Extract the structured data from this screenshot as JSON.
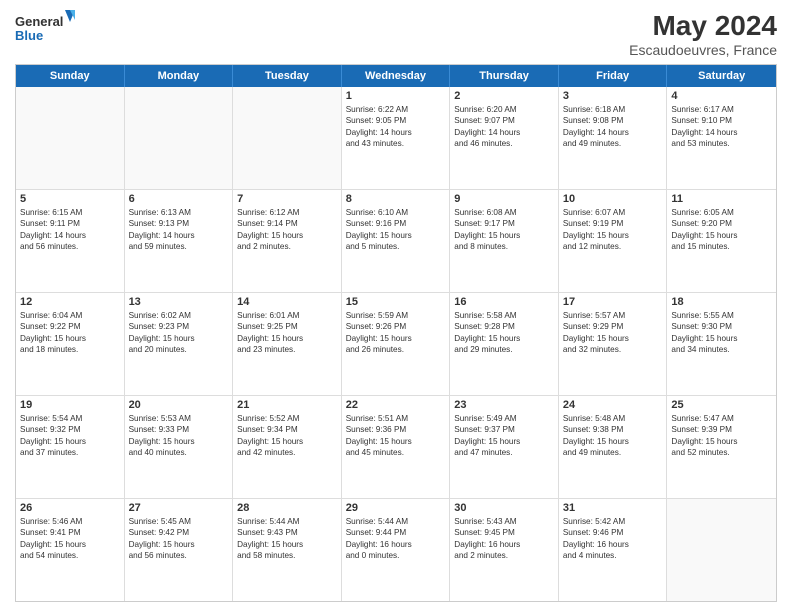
{
  "header": {
    "logo_line1": "General",
    "logo_line2": "Blue",
    "title": "May 2024",
    "subtitle": "Escaudoeuvres, France"
  },
  "days_of_week": [
    "Sunday",
    "Monday",
    "Tuesday",
    "Wednesday",
    "Thursday",
    "Friday",
    "Saturday"
  ],
  "weeks": [
    [
      {
        "day": "",
        "empty": true
      },
      {
        "day": "",
        "empty": true
      },
      {
        "day": "",
        "empty": true
      },
      {
        "day": "1",
        "line1": "Sunrise: 6:22 AM",
        "line2": "Sunset: 9:05 PM",
        "line3": "Daylight: 14 hours",
        "line4": "and 43 minutes."
      },
      {
        "day": "2",
        "line1": "Sunrise: 6:20 AM",
        "line2": "Sunset: 9:07 PM",
        "line3": "Daylight: 14 hours",
        "line4": "and 46 minutes."
      },
      {
        "day": "3",
        "line1": "Sunrise: 6:18 AM",
        "line2": "Sunset: 9:08 PM",
        "line3": "Daylight: 14 hours",
        "line4": "and 49 minutes."
      },
      {
        "day": "4",
        "line1": "Sunrise: 6:17 AM",
        "line2": "Sunset: 9:10 PM",
        "line3": "Daylight: 14 hours",
        "line4": "and 53 minutes."
      }
    ],
    [
      {
        "day": "5",
        "line1": "Sunrise: 6:15 AM",
        "line2": "Sunset: 9:11 PM",
        "line3": "Daylight: 14 hours",
        "line4": "and 56 minutes."
      },
      {
        "day": "6",
        "line1": "Sunrise: 6:13 AM",
        "line2": "Sunset: 9:13 PM",
        "line3": "Daylight: 14 hours",
        "line4": "and 59 minutes."
      },
      {
        "day": "7",
        "line1": "Sunrise: 6:12 AM",
        "line2": "Sunset: 9:14 PM",
        "line3": "Daylight: 15 hours",
        "line4": "and 2 minutes."
      },
      {
        "day": "8",
        "line1": "Sunrise: 6:10 AM",
        "line2": "Sunset: 9:16 PM",
        "line3": "Daylight: 15 hours",
        "line4": "and 5 minutes."
      },
      {
        "day": "9",
        "line1": "Sunrise: 6:08 AM",
        "line2": "Sunset: 9:17 PM",
        "line3": "Daylight: 15 hours",
        "line4": "and 8 minutes."
      },
      {
        "day": "10",
        "line1": "Sunrise: 6:07 AM",
        "line2": "Sunset: 9:19 PM",
        "line3": "Daylight: 15 hours",
        "line4": "and 12 minutes."
      },
      {
        "day": "11",
        "line1": "Sunrise: 6:05 AM",
        "line2": "Sunset: 9:20 PM",
        "line3": "Daylight: 15 hours",
        "line4": "and 15 minutes."
      }
    ],
    [
      {
        "day": "12",
        "line1": "Sunrise: 6:04 AM",
        "line2": "Sunset: 9:22 PM",
        "line3": "Daylight: 15 hours",
        "line4": "and 18 minutes."
      },
      {
        "day": "13",
        "line1": "Sunrise: 6:02 AM",
        "line2": "Sunset: 9:23 PM",
        "line3": "Daylight: 15 hours",
        "line4": "and 20 minutes."
      },
      {
        "day": "14",
        "line1": "Sunrise: 6:01 AM",
        "line2": "Sunset: 9:25 PM",
        "line3": "Daylight: 15 hours",
        "line4": "and 23 minutes."
      },
      {
        "day": "15",
        "line1": "Sunrise: 5:59 AM",
        "line2": "Sunset: 9:26 PM",
        "line3": "Daylight: 15 hours",
        "line4": "and 26 minutes."
      },
      {
        "day": "16",
        "line1": "Sunrise: 5:58 AM",
        "line2": "Sunset: 9:28 PM",
        "line3": "Daylight: 15 hours",
        "line4": "and 29 minutes."
      },
      {
        "day": "17",
        "line1": "Sunrise: 5:57 AM",
        "line2": "Sunset: 9:29 PM",
        "line3": "Daylight: 15 hours",
        "line4": "and 32 minutes."
      },
      {
        "day": "18",
        "line1": "Sunrise: 5:55 AM",
        "line2": "Sunset: 9:30 PM",
        "line3": "Daylight: 15 hours",
        "line4": "and 34 minutes."
      }
    ],
    [
      {
        "day": "19",
        "line1": "Sunrise: 5:54 AM",
        "line2": "Sunset: 9:32 PM",
        "line3": "Daylight: 15 hours",
        "line4": "and 37 minutes."
      },
      {
        "day": "20",
        "line1": "Sunrise: 5:53 AM",
        "line2": "Sunset: 9:33 PM",
        "line3": "Daylight: 15 hours",
        "line4": "and 40 minutes."
      },
      {
        "day": "21",
        "line1": "Sunrise: 5:52 AM",
        "line2": "Sunset: 9:34 PM",
        "line3": "Daylight: 15 hours",
        "line4": "and 42 minutes."
      },
      {
        "day": "22",
        "line1": "Sunrise: 5:51 AM",
        "line2": "Sunset: 9:36 PM",
        "line3": "Daylight: 15 hours",
        "line4": "and 45 minutes."
      },
      {
        "day": "23",
        "line1": "Sunrise: 5:49 AM",
        "line2": "Sunset: 9:37 PM",
        "line3": "Daylight: 15 hours",
        "line4": "and 47 minutes."
      },
      {
        "day": "24",
        "line1": "Sunrise: 5:48 AM",
        "line2": "Sunset: 9:38 PM",
        "line3": "Daylight: 15 hours",
        "line4": "and 49 minutes."
      },
      {
        "day": "25",
        "line1": "Sunrise: 5:47 AM",
        "line2": "Sunset: 9:39 PM",
        "line3": "Daylight: 15 hours",
        "line4": "and 52 minutes."
      }
    ],
    [
      {
        "day": "26",
        "line1": "Sunrise: 5:46 AM",
        "line2": "Sunset: 9:41 PM",
        "line3": "Daylight: 15 hours",
        "line4": "and 54 minutes."
      },
      {
        "day": "27",
        "line1": "Sunrise: 5:45 AM",
        "line2": "Sunset: 9:42 PM",
        "line3": "Daylight: 15 hours",
        "line4": "and 56 minutes."
      },
      {
        "day": "28",
        "line1": "Sunrise: 5:44 AM",
        "line2": "Sunset: 9:43 PM",
        "line3": "Daylight: 15 hours",
        "line4": "and 58 minutes."
      },
      {
        "day": "29",
        "line1": "Sunrise: 5:44 AM",
        "line2": "Sunset: 9:44 PM",
        "line3": "Daylight: 16 hours",
        "line4": "and 0 minutes."
      },
      {
        "day": "30",
        "line1": "Sunrise: 5:43 AM",
        "line2": "Sunset: 9:45 PM",
        "line3": "Daylight: 16 hours",
        "line4": "and 2 minutes."
      },
      {
        "day": "31",
        "line1": "Sunrise: 5:42 AM",
        "line2": "Sunset: 9:46 PM",
        "line3": "Daylight: 16 hours",
        "line4": "and 4 minutes."
      },
      {
        "day": "",
        "empty": true
      }
    ]
  ]
}
